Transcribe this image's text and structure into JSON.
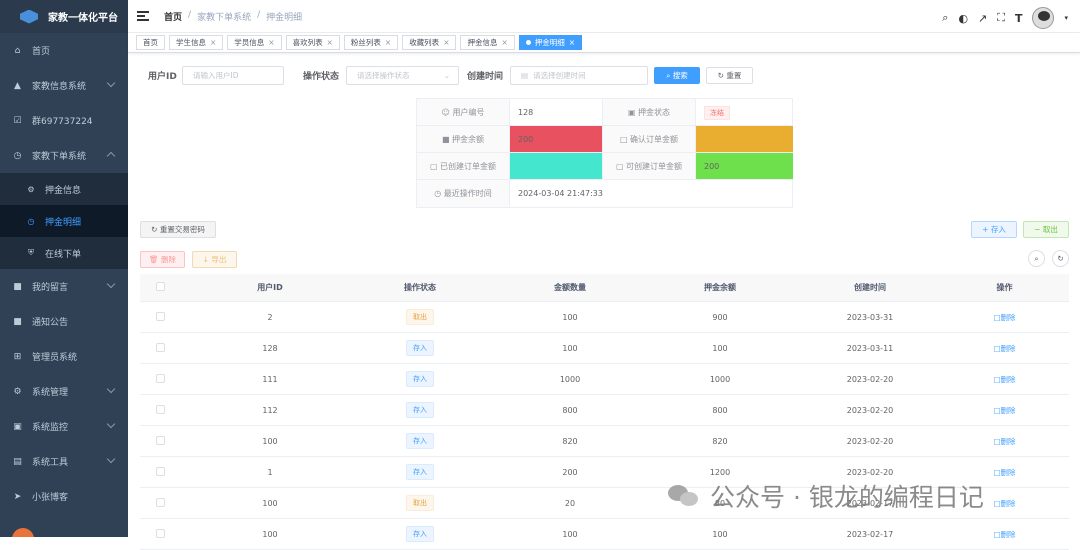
{
  "sidebar": {
    "logo_text": "家教一体化平台",
    "items": [
      {
        "label": "首页",
        "icon": "home-icon",
        "arrow": false
      },
      {
        "label": "家教信息系统",
        "icon": "graduation-icon",
        "arrow": "down"
      },
      {
        "label": "群697737224",
        "icon": "checkbox-icon",
        "arrow": false
      },
      {
        "label": "家教下单系统",
        "icon": "clock-icon",
        "arrow": "up"
      }
    ],
    "sub_items": [
      {
        "label": "押金信息",
        "icon": "settings-icon",
        "active": false
      },
      {
        "label": "押金明细",
        "icon": "clock-icon",
        "active": true
      },
      {
        "label": "在线下单",
        "icon": "shield-icon",
        "active": false
      }
    ],
    "items2": [
      {
        "label": "我的留言",
        "icon": "message-icon",
        "arrow": "down"
      },
      {
        "label": "通知公告",
        "icon": "notice-icon",
        "arrow": false
      },
      {
        "label": "管理员系统",
        "icon": "admin-icon",
        "arrow": false
      },
      {
        "label": "系统管理",
        "icon": "gear-icon",
        "arrow": "down"
      },
      {
        "label": "系统监控",
        "icon": "monitor-icon",
        "arrow": "down"
      },
      {
        "label": "系统工具",
        "icon": "tool-icon",
        "arrow": "down"
      },
      {
        "label": "小张博客",
        "icon": "send-icon",
        "arrow": false
      }
    ]
  },
  "breadcrumb": [
    "首页",
    "家教下单系统",
    "押金明细"
  ],
  "tags": [
    {
      "label": "首页",
      "closable": false,
      "active": false
    },
    {
      "label": "学生信息",
      "closable": true,
      "active": false
    },
    {
      "label": "学员信息",
      "closable": true,
      "active": false
    },
    {
      "label": "喜欢列表",
      "closable": true,
      "active": false
    },
    {
      "label": "粉丝列表",
      "closable": true,
      "active": false
    },
    {
      "label": "收藏列表",
      "closable": true,
      "active": false
    },
    {
      "label": "押金信息",
      "closable": true,
      "active": false
    },
    {
      "label": "押金明细",
      "closable": true,
      "active": true
    }
  ],
  "search": {
    "user_id_label": "用户ID",
    "user_id_placeholder": "请输入用户ID",
    "status_label": "操作状态",
    "status_placeholder": "请选择操作状态",
    "time_label": "创建时间",
    "time_placeholder": "请选择创建时间",
    "search_btn": "搜索",
    "reset_btn": "重置"
  },
  "desc": {
    "user_no_label": "用户编号",
    "user_no": "128",
    "status_label": "押金状态",
    "status": "冻结",
    "balance_label": "押金余额",
    "balance": "200",
    "confirm_label": "确认订单金额",
    "confirm": "",
    "created_label": "已创建订单金额",
    "created": "",
    "available_label": "可创建订单金额",
    "available": "200",
    "last_time_label": "最近操作时间",
    "last_time": "2024-03-04 21:47:33",
    "colors": {
      "balance": "#e8515f",
      "confirm": "#e9ae2f",
      "created": "#45e6ce",
      "available": "#6ee04c"
    }
  },
  "actions": {
    "reset_pwd": "重置交易密码",
    "deposit": "存入",
    "withdraw": "取出",
    "delete": "删除",
    "export": "导出"
  },
  "table": {
    "headers": [
      "用户ID",
      "操作状态",
      "金额数量",
      "押金余额",
      "创建时间",
      "操作"
    ],
    "rows": [
      {
        "uid": "2",
        "status": "取出",
        "amount": "100",
        "balance": "900",
        "time": "2023-03-31",
        "op": "删除"
      },
      {
        "uid": "128",
        "status": "存入",
        "amount": "100",
        "balance": "100",
        "time": "2023-03-11",
        "op": "删除"
      },
      {
        "uid": "111",
        "status": "存入",
        "amount": "1000",
        "balance": "1000",
        "time": "2023-02-20",
        "op": "删除"
      },
      {
        "uid": "112",
        "status": "存入",
        "amount": "800",
        "balance": "800",
        "time": "2023-02-20",
        "op": "删除"
      },
      {
        "uid": "100",
        "status": "存入",
        "amount": "820",
        "balance": "820",
        "time": "2023-02-20",
        "op": "删除"
      },
      {
        "uid": "1",
        "status": "存入",
        "amount": "200",
        "balance": "1200",
        "time": "2023-02-20",
        "op": "删除"
      },
      {
        "uid": "100",
        "status": "取出",
        "amount": "20",
        "balance": "80",
        "time": "2023-02-17",
        "op": "删除"
      },
      {
        "uid": "100",
        "status": "存入",
        "amount": "100",
        "balance": "100",
        "time": "2023-02-17",
        "op": "删除"
      }
    ]
  },
  "watermark": "公众号 · 银龙的编程日记"
}
